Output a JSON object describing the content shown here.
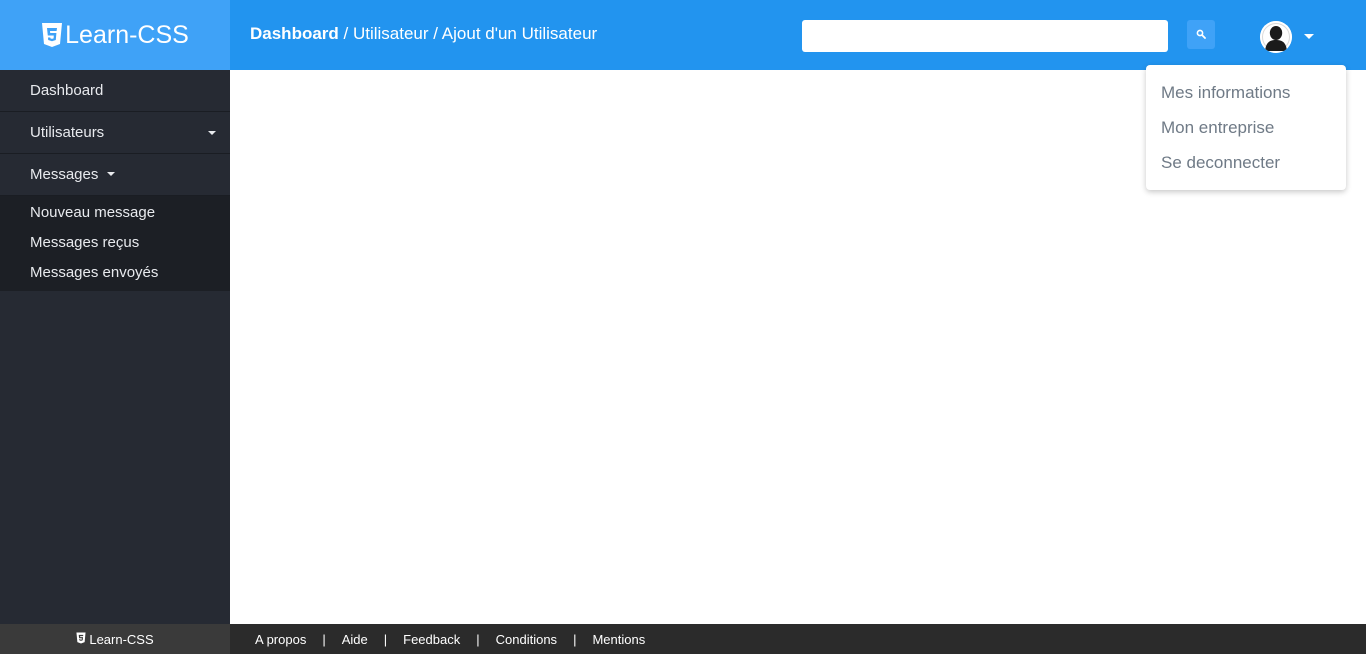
{
  "brand": {
    "name": "Learn-CSS"
  },
  "breadcrumb": {
    "root": "Dashboard",
    "separator": " / ",
    "section": "Utilisateur",
    "page": "Ajout d'un Utilisateur"
  },
  "search": {
    "value": "",
    "placeholder": "",
    "icon": "search-icon"
  },
  "user_menu": {
    "items": [
      "Mes informations",
      "Mon entreprise",
      "Se deconnecter"
    ]
  },
  "sidebar": {
    "items": [
      {
        "label": "Dashboard"
      },
      {
        "label": "Utilisateurs"
      },
      {
        "label": "Messages"
      }
    ],
    "messages_submenu": [
      "Nouveau message",
      "Messages reçus",
      "Messages envoyés"
    ]
  },
  "footer": {
    "brand": "Learn-CSS",
    "separator": "|",
    "links": [
      "A propos",
      "Aide",
      "Feedback",
      "Conditions",
      "Mentions"
    ]
  },
  "colors": {
    "brand_bg": "#3fa2f7",
    "header_bg": "#2294ef",
    "sidebar_bg": "#262a33",
    "submenu_bg": "#1c1f25",
    "footer_bg": "#2b2b2b",
    "dropdown_text": "#6f7a86"
  }
}
